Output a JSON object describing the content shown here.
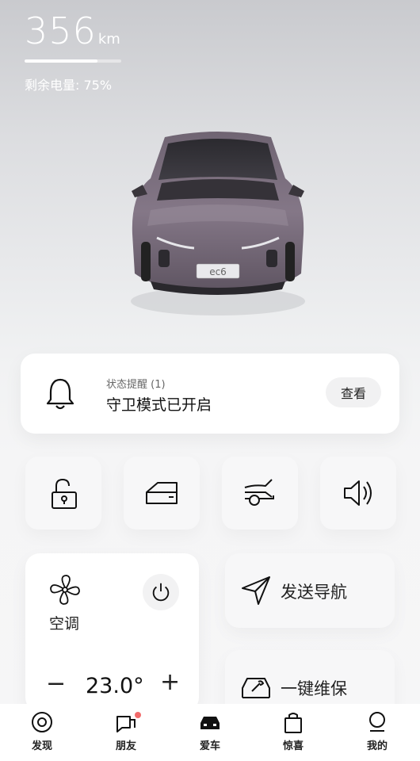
{
  "range": {
    "value": "356",
    "unit": "km",
    "battery_fraction": 0.75
  },
  "battery_text": "剩余电量: 75%",
  "car": {
    "plate_text": "ec6",
    "body_color": "#7d6f7f"
  },
  "status": {
    "subtitle": "状态提醒 (1)",
    "title": "守卫模式已开启",
    "action": "查看"
  },
  "quick_actions": [
    {
      "icon": "unlock-icon"
    },
    {
      "icon": "car-door-icon"
    },
    {
      "icon": "trunk-icon"
    },
    {
      "icon": "speaker-icon"
    }
  ],
  "climate": {
    "label": "空调",
    "temperature": "23.0°",
    "minus": "−",
    "plus": "+"
  },
  "navigation": {
    "label": "发送导航"
  },
  "maintenance": {
    "label": "一键维保"
  },
  "tabs": [
    {
      "label": "发现",
      "icon": "target-icon"
    },
    {
      "label": "朋友",
      "icon": "chat-icon"
    },
    {
      "label": "爱车",
      "icon": "car-icon"
    },
    {
      "label": "惊喜",
      "icon": "shopping-bag-icon"
    },
    {
      "label": "我的",
      "icon": "profile-icon"
    }
  ],
  "colors": {
    "notification_dot": "#f26b6b"
  }
}
